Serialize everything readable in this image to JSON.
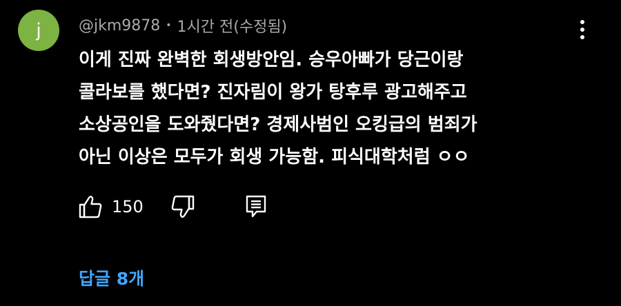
{
  "comment": {
    "avatar_letter": "j",
    "avatar_color": "#7cb342",
    "author": "@jkm9878",
    "separator": "•",
    "timestamp": "1시간 전(수정됨)",
    "lines": [
      "이게 진짜 완벽한 회생방안임. 승우아빠가 당근이랑",
      "콜라보를 했다면? 진자림이 왕가 탕후루 광고해주고",
      "소상공인을 도와줬다면? 경제사범인 오킹급의 범죄가",
      "아닌 이상은 모두가 회생 가능함. 피식대학처럼 ㅇㅇ"
    ],
    "like_count": "150",
    "replies_label": "답글 8개",
    "icons": {
      "like": "thumbs-up-icon",
      "dislike": "thumbs-down-icon",
      "reply": "reply-icon",
      "menu": "more-vertical-icon"
    },
    "colors": {
      "background": "#000000",
      "meta_text": "#aaaaaa",
      "link": "#3ea6ff"
    }
  }
}
